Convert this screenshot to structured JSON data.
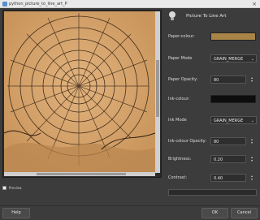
{
  "window": {
    "title": "python_picture_to_line_art_P"
  },
  "plugin": {
    "title": "Picture To Line Art"
  },
  "preview": {
    "checkbox_label": "Preview",
    "checked": true
  },
  "params": {
    "paper_colour": {
      "label": "Paper-colour:",
      "color": "#a88446"
    },
    "paper_mode": {
      "label": "Paper Mode",
      "value": "GRAIN_MERGE"
    },
    "paper_opacity": {
      "label": "Paper Opacity:",
      "value": "80"
    },
    "ink_colour": {
      "label": "Ink-colour:",
      "color": "#0d0d0d"
    },
    "ink_mode": {
      "label": "Ink Mode",
      "value": "GRAIN_MERGE"
    },
    "ink_opacity": {
      "label": "Ink-colour Opacity:",
      "value": "80"
    },
    "brightness": {
      "label": "Brightness:",
      "value": "0.20"
    },
    "contrast": {
      "label": "Contrast:",
      "value": "0.40"
    }
  },
  "buttons": {
    "help": "Help",
    "ok": "OK",
    "cancel": "Cancel"
  },
  "colors": {
    "paper_tone": "#d9a974",
    "ink_tone": "#2a1a0d"
  }
}
